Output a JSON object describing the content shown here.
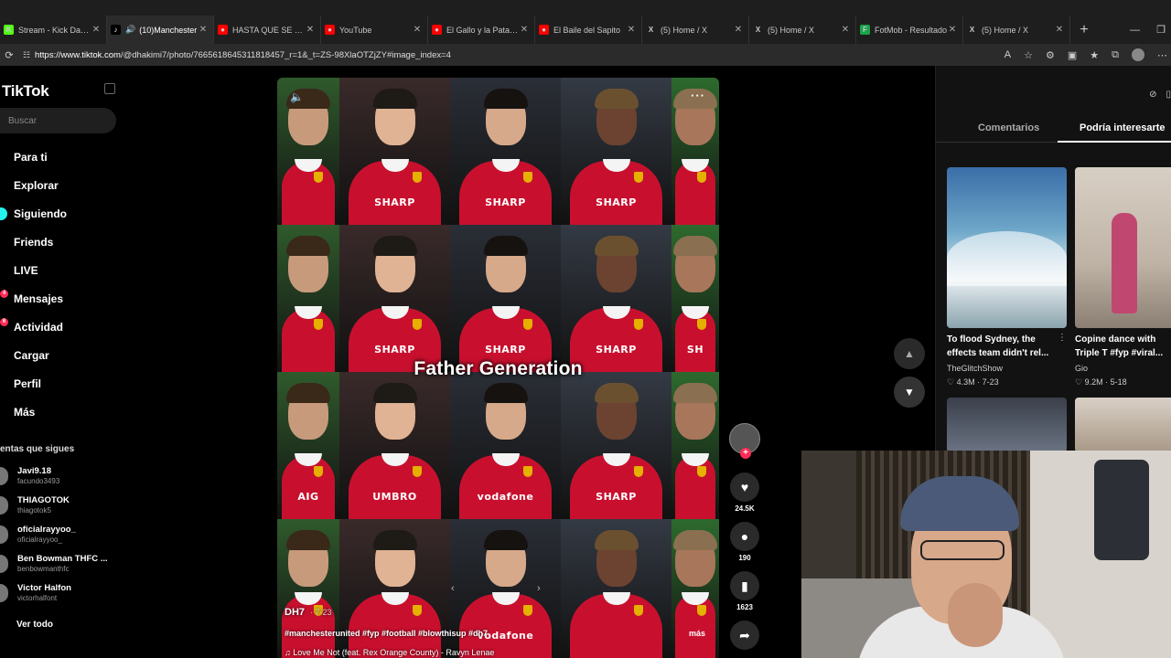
{
  "browser": {
    "tabs": [
      {
        "label": "Stream - Kick Dashb",
        "fav": "K",
        "color": "#53fc18",
        "active": false
      },
      {
        "label": "(10)Manchester",
        "fav": "♪",
        "color": "#000000",
        "active": true
      },
      {
        "label": "HASTA QUE SE TE R",
        "fav": "●",
        "color": "#ff0000",
        "active": false
      },
      {
        "label": "YouTube",
        "fav": "●",
        "color": "#ff0000",
        "active": false
      },
      {
        "label": "El Gallo y la Pata - C",
        "fav": "●",
        "color": "#ff0000",
        "active": false
      },
      {
        "label": "El Baile del Sapito",
        "fav": "●",
        "color": "#ff0000",
        "active": false
      },
      {
        "label": "(5) Home / X",
        "fav": "X",
        "color": "#1e1e1e",
        "active": false
      },
      {
        "label": "(5) Home / X",
        "fav": "X",
        "color": "#1e1e1e",
        "active": false
      },
      {
        "label": "FotMob - Resultado",
        "fav": "F",
        "color": "#1aa34a",
        "active": false
      },
      {
        "label": "(5) Home / X",
        "fav": "X",
        "color": "#1e1e1e",
        "active": false
      }
    ],
    "url_host": "https://www.tiktok.com",
    "url_path": "/@dhakimi7/photo/7665618645311818457_r=1&_t=ZS-98XlaOTZjZY#image_index=4"
  },
  "sidebar": {
    "logo": "TikTok",
    "search_placeholder": "Buscar",
    "nav": [
      {
        "label": "Para ti",
        "badge": ""
      },
      {
        "label": "Explorar",
        "badge": ""
      },
      {
        "label": "Siguiendo",
        "badge": ""
      },
      {
        "label": "Friends",
        "badge": ""
      },
      {
        "label": "LIVE",
        "badge": ""
      },
      {
        "label": "Mensajes",
        "badge": "4"
      },
      {
        "label": "Actividad",
        "badge": "6"
      },
      {
        "label": "Cargar",
        "badge": ""
      },
      {
        "label": "Perfil",
        "badge": ""
      },
      {
        "label": "Más",
        "badge": ""
      }
    ],
    "following_title": "entas que sigues",
    "accounts": [
      {
        "name": "Javi9.18",
        "handle": "facundo3493"
      },
      {
        "name": "THIAGOTOK",
        "handle": "thiagotok5"
      },
      {
        "name": "oficialrayyoo_",
        "handle": "oficialrayyoo_"
      },
      {
        "name": "Ben Bowman THFC ...",
        "handle": "benbowmanthfc"
      },
      {
        "name": "Victor Halfon",
        "handle": "victorhalfont"
      }
    ],
    "see_all": "Ver todo"
  },
  "video": {
    "overlay_title": "Father Generation",
    "author": "DH7",
    "date": "· 7-23",
    "description": "#manchesterunited #fyp #football #blowthisup #dh7",
    "music": "♫ Love Me Not (feat. Rex Orange County) - Ravyn Lenae",
    "more": "más",
    "sponsors": [
      "",
      "SHARP",
      "SHARP",
      "SHARP",
      "",
      "",
      "SHARP",
      "SHARP",
      "SHARP",
      "SH",
      "AIG",
      "UMBRO",
      "vodafone",
      "SHARP",
      "",
      "",
      "",
      "vodafone",
      "",
      ""
    ]
  },
  "actions": {
    "likes": "24.5K",
    "comments": "190",
    "saves": "1623"
  },
  "right": {
    "tab_comments": "Comentarios",
    "tab_interest": "Podría interesarte",
    "recs": [
      {
        "title": "To flood Sydney, the effects team didn't rel...",
        "author": "TheGlitchShow",
        "stats": "♡ 4.3M · 7-23"
      },
      {
        "title": "Copine dance with Triple T #fyp #viral...",
        "author": "Gio",
        "stats": "♡ 9.2M · 5-18"
      }
    ]
  }
}
